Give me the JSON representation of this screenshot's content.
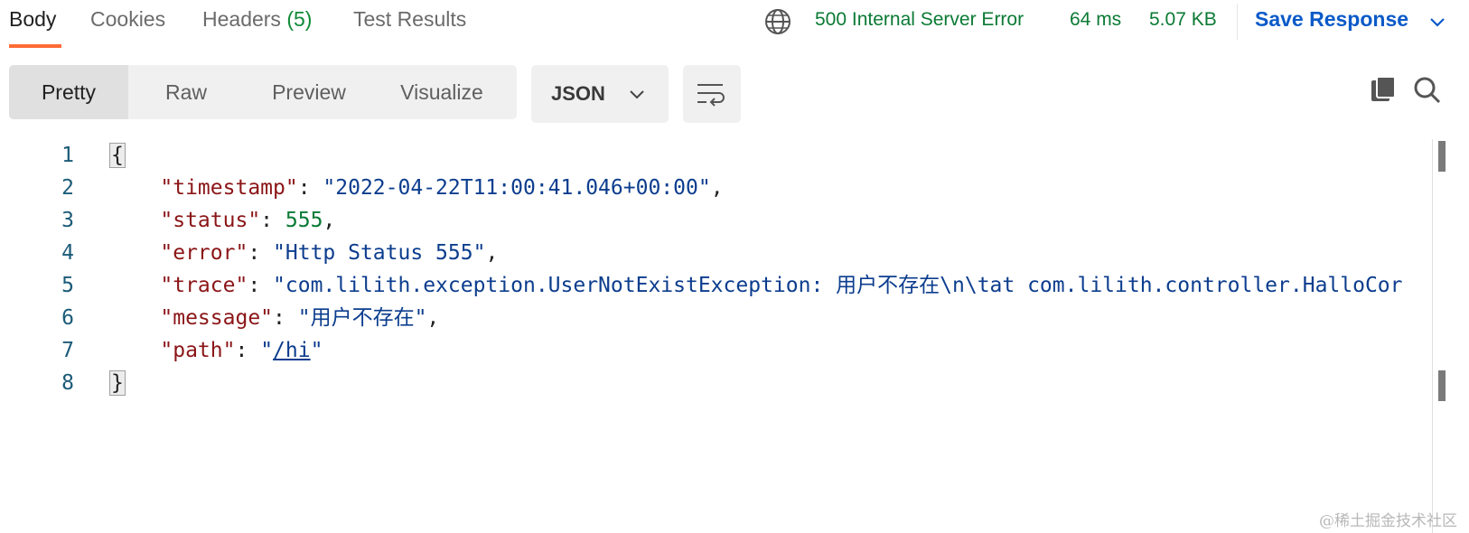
{
  "tabs": {
    "body": "Body",
    "cookies": "Cookies",
    "headers": "Headers",
    "headers_count": "(5)",
    "test_results": "Test Results"
  },
  "response": {
    "status": "500 Internal Server Error",
    "time": "64 ms",
    "size": "5.07 KB",
    "save_label": "Save Response"
  },
  "view_modes": [
    "Pretty",
    "Raw",
    "Preview",
    "Visualize"
  ],
  "active_view": "Pretty",
  "format": "JSON",
  "code": {
    "line_numbers": [
      "1",
      "2",
      "3",
      "4",
      "5",
      "6",
      "7",
      "8"
    ],
    "open_brace": "{",
    "close_brace": "}",
    "fields": {
      "timestamp": {
        "key": "\"timestamp\"",
        "value": "\"2022-04-22T11:00:41.046+00:00\""
      },
      "status": {
        "key": "\"status\"",
        "value": "555"
      },
      "error": {
        "key": "\"error\"",
        "value": "\"Http Status 555\""
      },
      "trace": {
        "key": "\"trace\"",
        "value": "\"com.lilith.exception.UserNotExistException: 用户不存在\\n\\tat com.lilith.controller.HalloCor"
      },
      "message": {
        "key": "\"message\"",
        "value": "\"用户不存在\""
      },
      "path": {
        "key": "\"path\"",
        "value_open": "\"",
        "value_link": "/hi",
        "value_close": "\""
      }
    }
  },
  "watermark": "@稀土掘金技术社区",
  "colors": {
    "accent": "#ff6c37",
    "status_green": "#0b7a35",
    "save_blue": "#0b5ac8",
    "json_key": "#8b1517",
    "json_string": "#0c3d8e",
    "json_number": "#0a7a35"
  }
}
